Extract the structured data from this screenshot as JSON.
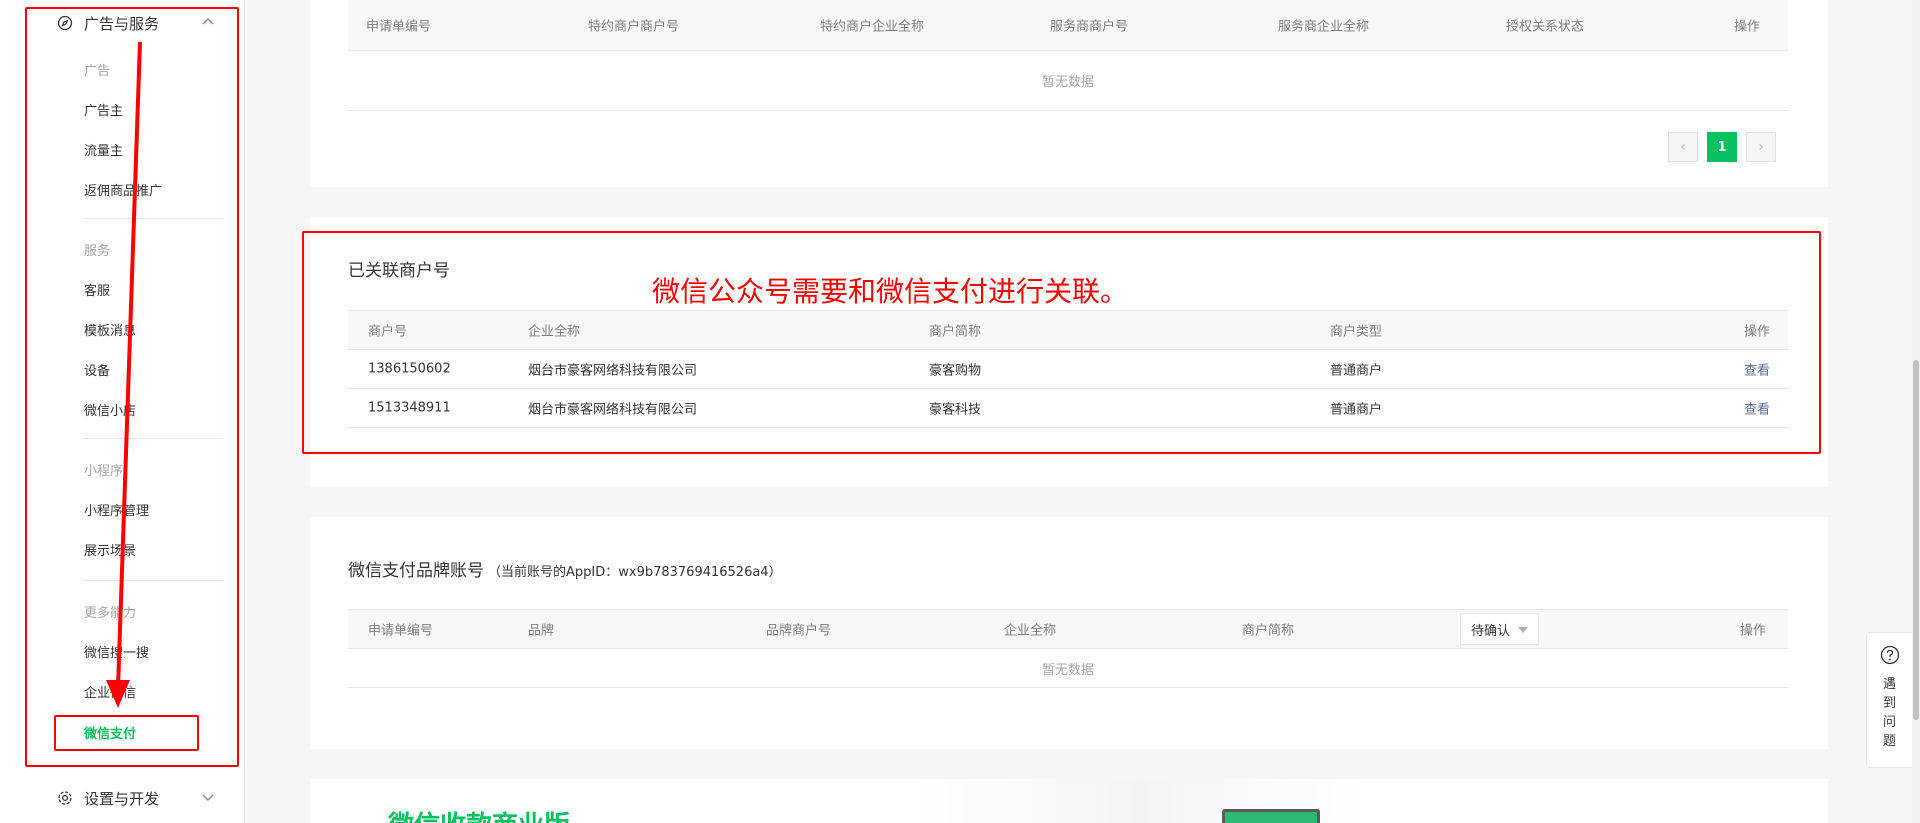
{
  "sidebar": {
    "ad_service_header": "广告与服务",
    "sections": [
      {
        "label": "广告",
        "items": [
          "广告主",
          "流量主",
          "返佣商品推广"
        ]
      },
      {
        "label": "服务",
        "items": [
          "客服",
          "模板消息",
          "设备",
          "微信小店"
        ]
      },
      {
        "label": "小程序",
        "items": [
          "小程序管理",
          "展示场景"
        ]
      },
      {
        "label": "更多能力",
        "items": [
          "微信搜一搜",
          "企业微信",
          "微信支付"
        ]
      }
    ],
    "settings_header": "设置与开发"
  },
  "auth_table": {
    "columns": [
      "申请单编号",
      "特约商户商户号",
      "特约商户企业全称",
      "服务商商户号",
      "服务商企业全称",
      "授权关系状态",
      "操作"
    ],
    "empty_text": "暂无数据",
    "pagination": {
      "current_page": "1",
      "prev_icon": "chevron-left",
      "next_icon": "chevron-right"
    }
  },
  "linked_merchants": {
    "title": "已关联商户号",
    "columns": [
      "商户号",
      "企业全称",
      "商户简称",
      "商户类型",
      "操作"
    ],
    "rows": [
      {
        "id": "1386150602",
        "company": "烟台市豪客网络科技有限公司",
        "short": "豪客购物",
        "type": "普通商户",
        "action": "查看"
      },
      {
        "id": "1513348911",
        "company": "烟台市豪客网络科技有限公司",
        "short": "豪客科技",
        "type": "普通商户",
        "action": "查看"
      }
    ]
  },
  "brand_account": {
    "title": "微信支付品牌账号",
    "appid_note": "（当前账号的AppID：wx9b783769416526a4）",
    "columns": [
      "申请单编号",
      "品牌",
      "品牌商户号",
      "企业全称",
      "商户简称",
      "操作"
    ],
    "status_filter": "待确认",
    "empty_text": "暂无数据"
  },
  "promo": {
    "title": "微信收款商业版"
  },
  "help": {
    "label": "遇到问题"
  },
  "annotation": {
    "text": "微信公众号需要和微信支付进行关联。"
  },
  "colors": {
    "brand_green": "#07c160",
    "annotation_red": "#ff0000",
    "link": "#576b95"
  }
}
